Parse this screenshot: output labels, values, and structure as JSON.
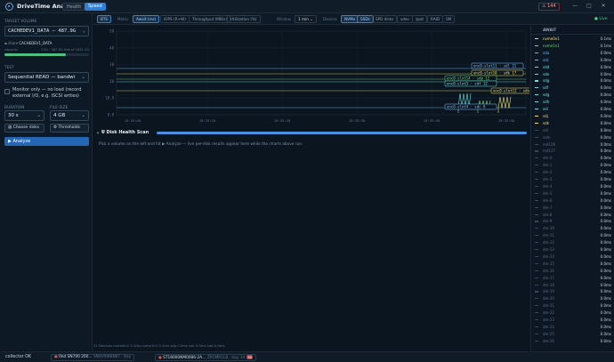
{
  "app": {
    "title": "DriveTime Analyzer",
    "tab_health": "Health",
    "tab_speed": "Speed",
    "alert_count": "144",
    "minimize": "—",
    "maximize": "□",
    "close": "✕"
  },
  "left": {
    "target_volume_label": "TARGET VOLUME",
    "volume_value": "CACHEDEV1_DATA — 487.9G",
    "share_prefix": "share",
    "share_name": "CACHEDEV1_DATA",
    "capacity_label": "capacity",
    "capacity_text": "73% · 487.9G free of 1831.1G",
    "capacity_fraction": 0.73,
    "test_label": "TEST",
    "test_value": "Sequential READ — bandwi",
    "monitor_text": "Monitor only — no load (record external I/O, e.g. iSCSI writes)",
    "duration_label": "DURATION",
    "duration_value": "30 s",
    "filesize_label": "FILE SIZE",
    "filesize_value": "4 GB",
    "choose_disks": "Choose disks",
    "thresholds": "Thresholds",
    "analyze": "Analyze"
  },
  "toolbar": {
    "chips_left": [
      "BTS"
    ],
    "metric_label": "Metric",
    "metrics": [
      "Await (ms)",
      "IOPS (R+W)",
      "Throughput (MB/s)",
      "Utilization (%)"
    ],
    "window_label": "Window",
    "window_value": "1 min",
    "devices_label": "Devices",
    "devices": [
      "NVMe",
      "SSDs",
      "SPD disks",
      "sdev",
      "zpot",
      "RAID",
      "SM"
    ],
    "live": "Live"
  },
  "chart_data": {
    "type": "line",
    "y_ticks": [
      "58",
      "48",
      "38",
      "28",
      "18.9",
      "0.8"
    ],
    "x_ticks": [
      "19:35:00",
      "19:35:10",
      "19:35:20",
      "19:35:30",
      "19:35:40",
      "19:35:50"
    ],
    "series": [
      {
        "name": "enc0-slot11 · sdl",
        "label_value": "21",
        "color": "#7fc3ff"
      },
      {
        "name": "enc0-slot10 · sdk",
        "label_value": "17",
        "color": "#f2e26b"
      },
      {
        "name": "enc0-slot14 · sdp",
        "label_value": "12",
        "color": "#7ad87a"
      },
      {
        "name": "enc0-slot3 · sdf",
        "label_value": "12",
        "color": "#6fe0e0"
      },
      {
        "name": "enc0-slot12 · sdn",
        "label_value": "8",
        "color": "#f2e26b"
      },
      {
        "name": "enc0-slot4 · sdc",
        "label_value": "8",
        "color": "#7fc3ff"
      }
    ]
  },
  "right": {
    "header": "AWAIT",
    "rows": [
      {
        "name": "nvme0n1",
        "value": "0.1ms",
        "color": "#f2e26b"
      },
      {
        "name": "nvme1n1",
        "value": "0.1ms",
        "color": "#7ad87a"
      },
      {
        "name": "sda",
        "value": "0.0ms",
        "color": "#6fb8f0"
      },
      {
        "name": "sdc",
        "value": "0.0ms",
        "color": "#6fb8f0"
      },
      {
        "name": "sdd",
        "value": "0.0ms",
        "color": "#6fe0e0"
      },
      {
        "name": "sde",
        "value": "0.0ms",
        "color": "#6fe0e0"
      },
      {
        "name": "sdg",
        "value": "0.0ms",
        "color": "#6fe0e0"
      },
      {
        "name": "sdf",
        "value": "0.0ms",
        "color": "#6fe0e0"
      },
      {
        "name": "sdg",
        "value": "0.0ms",
        "color": "#6fe0e0"
      },
      {
        "name": "sdh",
        "value": "0.0ms",
        "color": "#6fe0e0"
      },
      {
        "name": "sdi",
        "value": "0.0ms",
        "color": "#6fe0e0"
      },
      {
        "name": "sdj",
        "value": "0.0ms",
        "color": "#f2e26b"
      },
      {
        "name": "sdk",
        "value": "0.0ms",
        "color": "#f2e26b"
      },
      {
        "name": "sdl",
        "value": "0.0ms",
        "color": "#3b4a5a"
      },
      {
        "name": "sdm",
        "value": "0.0ms",
        "color": "#3b4a5a"
      },
      {
        "name": "md126",
        "value": "0.0ms",
        "color": "#3b4a5a"
      },
      {
        "name": "md127",
        "value": "0.0ms",
        "color": "#3b4a5a"
      },
      {
        "name": "dm-0",
        "value": "0.0ms",
        "color": "#3b4a5a"
      },
      {
        "name": "dm-1",
        "value": "0.0ms",
        "color": "#3b4a5a"
      },
      {
        "name": "dm-2",
        "value": "0.0ms",
        "color": "#3b4a5a"
      },
      {
        "name": "dm-3",
        "value": "0.0ms",
        "color": "#3b4a5a"
      },
      {
        "name": "dm-4",
        "value": "0.0ms",
        "color": "#3b4a5a"
      },
      {
        "name": "dm-5",
        "value": "0.0ms",
        "color": "#3b4a5a"
      },
      {
        "name": "dm-6",
        "value": "0.0ms",
        "color": "#3b4a5a"
      },
      {
        "name": "dm-7",
        "value": "0.0ms",
        "color": "#3b4a5a"
      },
      {
        "name": "dm-8",
        "value": "0.0ms",
        "color": "#3b4a5a"
      },
      {
        "name": "dm-9",
        "value": "0.0ms",
        "color": "#3b4a5a"
      },
      {
        "name": "dm-10",
        "value": "0.0ms",
        "color": "#3b4a5a"
      },
      {
        "name": "dm-11",
        "value": "0.0ms",
        "color": "#3b4a5a"
      },
      {
        "name": "dm-12",
        "value": "0.0ms",
        "color": "#3b4a5a"
      },
      {
        "name": "dm-13",
        "value": "0.0ms",
        "color": "#3b4a5a"
      },
      {
        "name": "dm-14",
        "value": "0.0ms",
        "color": "#3b4a5a"
      },
      {
        "name": "dm-15",
        "value": "0.0ms",
        "color": "#3b4a5a"
      },
      {
        "name": "dm-16",
        "value": "0.0ms",
        "color": "#3b4a5a"
      },
      {
        "name": "dm-17",
        "value": "0.0ms",
        "color": "#3b4a5a"
      },
      {
        "name": "dm-18",
        "value": "0.0ms",
        "color": "#3b4a5a"
      },
      {
        "name": "dm-19",
        "value": "0.0ms",
        "color": "#3b4a5a"
      },
      {
        "name": "dm-20",
        "value": "0.0ms",
        "color": "#3b4a5a"
      },
      {
        "name": "dm-21",
        "value": "0.0ms",
        "color": "#3b4a5a"
      },
      {
        "name": "dm-22",
        "value": "0.0ms",
        "color": "#3b4a5a"
      },
      {
        "name": "dm-23",
        "value": "0.0ms",
        "color": "#3b4a5a"
      },
      {
        "name": "dm-24",
        "value": "0.0ms",
        "color": "#3b4a5a"
      },
      {
        "name": "dm-25",
        "value": "0.0ms",
        "color": "#3b4a5a"
      },
      {
        "name": "dm-26",
        "value": "0.0ms",
        "color": "#3b4a5a"
      }
    ]
  },
  "scan": {
    "title": "Disk Health Scan",
    "hint": "Pick a volume on the left and hit ▶ Analyze — live per-disk results appear here while the charts above run."
  },
  "legend": {
    "text": "41 Devices  nvme0n1 0.1ms  nvme1n1 0.1ms  sda 0.0ms  sdc 0.0ms  sdd 0.0ms"
  },
  "status": {
    "collector": "collector OK",
    "disk1_name": "Red SN700 200…",
    "disk1_meta": "SN4V0WBNET · bay",
    "disk2_name": "ST18000NM0086-2A…",
    "disk2_meta": "ZR5MR1LB · bay 14",
    "disk2_badge": "38"
  }
}
